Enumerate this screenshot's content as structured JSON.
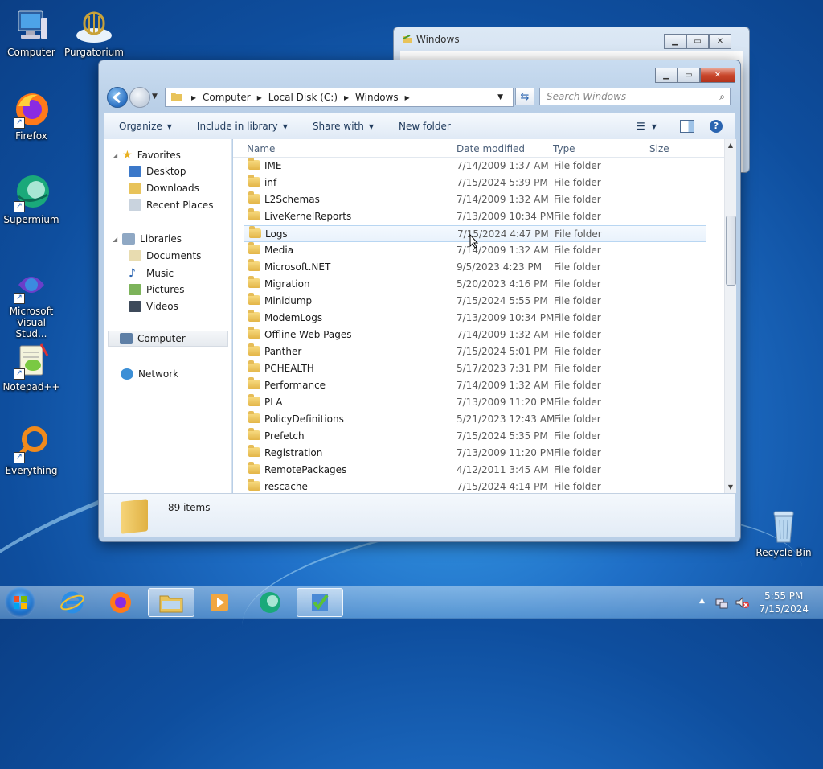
{
  "desktop": {
    "icons": [
      {
        "label": "Computer"
      },
      {
        "label": "Purgatorium"
      },
      {
        "label": "Firefox"
      },
      {
        "label": "Supermium"
      },
      {
        "label": "Microsoft Visual Stud..."
      },
      {
        "label": "Notepad++"
      },
      {
        "label": "Everything"
      },
      {
        "label": "Recycle Bin"
      }
    ]
  },
  "background_window": {
    "title": "Windows"
  },
  "explorer": {
    "breadcrumb": [
      "Computer",
      "Local Disk (C:)",
      "Windows"
    ],
    "search_placeholder": "Search Windows",
    "toolbar": {
      "organize": "Organize",
      "include_in_library": "Include in library",
      "share_with": "Share with",
      "new_folder": "New folder"
    },
    "nav": {
      "favorites": "Favorites",
      "desktop": "Desktop",
      "downloads": "Downloads",
      "recent_places": "Recent Places",
      "libraries": "Libraries",
      "documents": "Documents",
      "music": "Music",
      "pictures": "Pictures",
      "videos": "Videos",
      "computer": "Computer",
      "network": "Network"
    },
    "columns": {
      "name": "Name",
      "date": "Date modified",
      "type": "Type",
      "size": "Size"
    },
    "rows": [
      {
        "name": "IME",
        "date": "7/14/2009 1:37 AM",
        "type": "File folder"
      },
      {
        "name": "inf",
        "date": "7/15/2024 5:39 PM",
        "type": "File folder"
      },
      {
        "name": "L2Schemas",
        "date": "7/14/2009 1:32 AM",
        "type": "File folder"
      },
      {
        "name": "LiveKernelReports",
        "date": "7/13/2009 10:34 PM",
        "type": "File folder"
      },
      {
        "name": "Logs",
        "date": "7/15/2024 4:47 PM",
        "type": "File folder"
      },
      {
        "name": "Media",
        "date": "7/14/2009 1:32 AM",
        "type": "File folder"
      },
      {
        "name": "Microsoft.NET",
        "date": "9/5/2023 4:23 PM",
        "type": "File folder"
      },
      {
        "name": "Migration",
        "date": "5/20/2023 4:16 PM",
        "type": "File folder"
      },
      {
        "name": "Minidump",
        "date": "7/15/2024 5:55 PM",
        "type": "File folder"
      },
      {
        "name": "ModemLogs",
        "date": "7/13/2009 10:34 PM",
        "type": "File folder"
      },
      {
        "name": "Offline Web Pages",
        "date": "7/14/2009 1:32 AM",
        "type": "File folder"
      },
      {
        "name": "Panther",
        "date": "7/15/2024 5:01 PM",
        "type": "File folder"
      },
      {
        "name": "PCHEALTH",
        "date": "5/17/2023 7:31 PM",
        "type": "File folder"
      },
      {
        "name": "Performance",
        "date": "7/14/2009 1:32 AM",
        "type": "File folder"
      },
      {
        "name": "PLA",
        "date": "7/13/2009 11:20 PM",
        "type": "File folder"
      },
      {
        "name": "PolicyDefinitions",
        "date": "5/21/2023 12:43 AM",
        "type": "File folder"
      },
      {
        "name": "Prefetch",
        "date": "7/15/2024 5:35 PM",
        "type": "File folder"
      },
      {
        "name": "Registration",
        "date": "7/13/2009 11:20 PM",
        "type": "File folder"
      },
      {
        "name": "RemotePackages",
        "date": "4/12/2011 3:45 AM",
        "type": "File folder"
      },
      {
        "name": "rescache",
        "date": "7/15/2024 4:14 PM",
        "type": "File folder"
      }
    ],
    "status": "89 items"
  },
  "taskbar": {
    "time": "5:55 PM",
    "date": "7/15/2024"
  }
}
